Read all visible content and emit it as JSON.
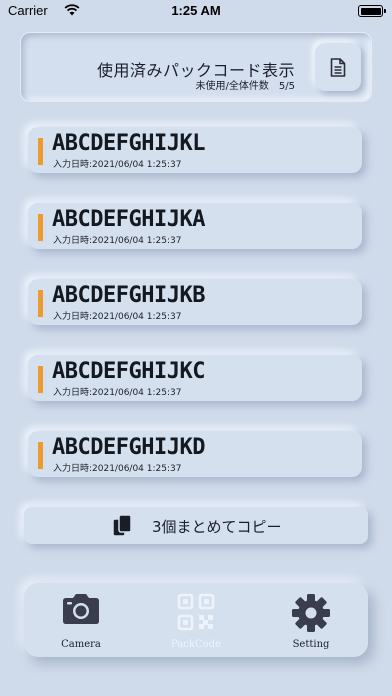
{
  "status_bar": {
    "carrier": "Carrier",
    "time": "1:25 AM"
  },
  "header": {
    "title": "使用済みパックコード表示",
    "subtitle": "未使用/全体件数　5/5",
    "doc_icon": "document-icon"
  },
  "codes": [
    {
      "code": "ABCDEFGHIJKL",
      "date": "入力日時:2021/06/04 1:25:37"
    },
    {
      "code": "ABCDEFGHIJKA",
      "date": "入力日時:2021/06/04 1:25:37"
    },
    {
      "code": "ABCDEFGHIJKB",
      "date": "入力日時:2021/06/04 1:25:37"
    },
    {
      "code": "ABCDEFGHIJKC",
      "date": "入力日時:2021/06/04 1:25:37"
    },
    {
      "code": "ABCDEFGHIJKD",
      "date": "入力日時:2021/06/04 1:25:37"
    }
  ],
  "copy_button": {
    "label": "3個まとめてコピー",
    "icon": "copy-icon"
  },
  "tabs": [
    {
      "label": "Camera",
      "icon": "camera-icon"
    },
    {
      "label": "PackCode",
      "icon": "qr-code-icon"
    },
    {
      "label": "Setting",
      "icon": "gear-icon"
    }
  ],
  "colors": {
    "background": "#cfdaea",
    "accent_bar": "#ee9a2c",
    "icon_dark": "#3a3d4e"
  }
}
